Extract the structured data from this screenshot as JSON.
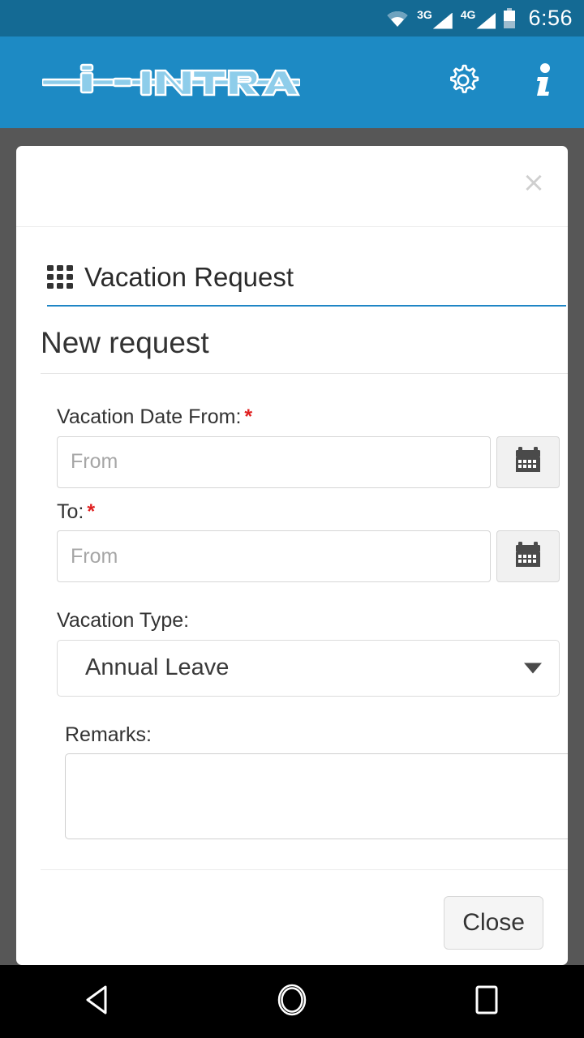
{
  "status_bar": {
    "wifi_icon": "wifi-icon",
    "sim1_label": "3G",
    "sim2_label": "4G",
    "battery_icon": "battery-icon",
    "time": "6:56",
    "background_color": "#146a94"
  },
  "app_bar": {
    "logo_text": "i-INTRA",
    "settings_icon": "gear-icon",
    "info_icon": "info-icon",
    "background_color": "#1d8ac4"
  },
  "dialog": {
    "close_label": "×",
    "module_icon": "grid-icon",
    "module_title": "Vacation Request",
    "section_title": "New request",
    "accent_color": "#1f86c5",
    "fields": {
      "date_from": {
        "label": "Vacation Date From:",
        "required_marker": "*",
        "value": "",
        "placeholder": "From",
        "calendar_icon": "calendar-icon"
      },
      "date_to": {
        "label": "To:",
        "required_marker": "*",
        "value": "",
        "placeholder": "From",
        "calendar_icon": "calendar-icon"
      },
      "vacation_type": {
        "label": "Vacation Type:",
        "selected": "Annual Leave",
        "caret_icon": "chevron-down-icon"
      },
      "remarks": {
        "label": "Remarks:",
        "value": "",
        "placeholder": ""
      }
    },
    "close_button_label": "Close"
  },
  "nav_bar": {
    "back_icon": "back-triangle-icon",
    "home_icon": "home-circle-icon",
    "recents_icon": "recents-square-icon",
    "background_color": "#000000"
  }
}
